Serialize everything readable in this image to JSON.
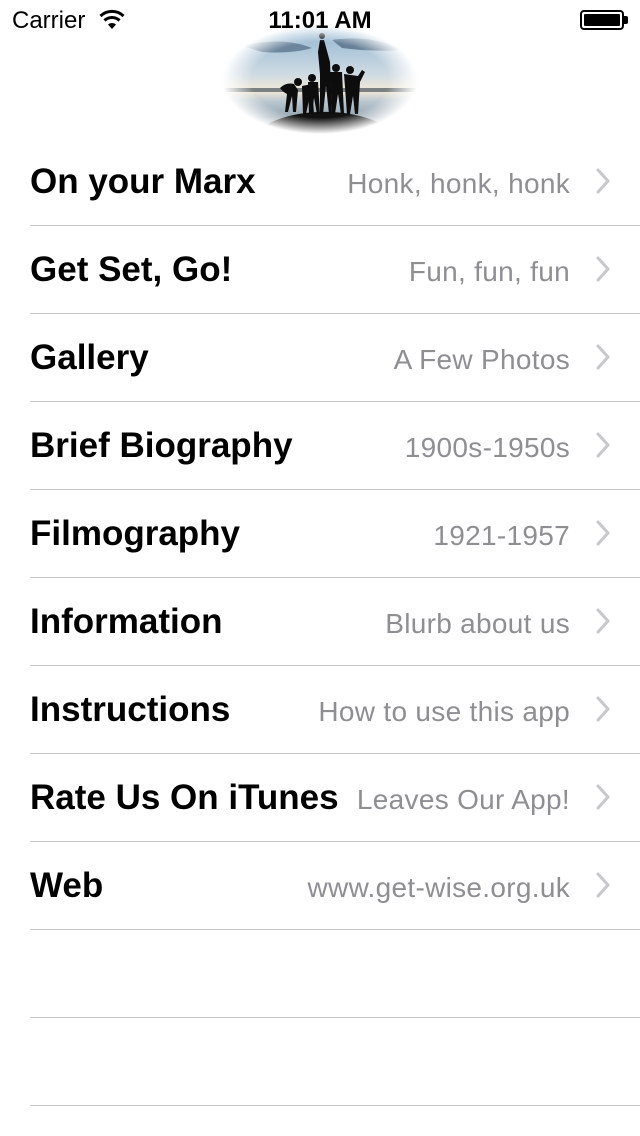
{
  "status_bar": {
    "carrier": "Carrier",
    "time": "11:01 AM",
    "wifi_icon": "wifi-icon",
    "battery_icon": "battery-icon"
  },
  "header": {
    "logo_icon": "group-silhouette-logo"
  },
  "menu": {
    "items": [
      {
        "title": "On your Marx",
        "detail": "Honk, honk, honk"
      },
      {
        "title": "Get Set, Go!",
        "detail": "Fun, fun, fun"
      },
      {
        "title": "Gallery",
        "detail": "A Few Photos"
      },
      {
        "title": "Brief Biography",
        "detail": "1900s-1950s"
      },
      {
        "title": "Filmography",
        "detail": "1921-1957"
      },
      {
        "title": "Information",
        "detail": "Blurb about us"
      },
      {
        "title": "Instructions",
        "detail": "How to use this app"
      },
      {
        "title": "Rate Us On iTunes",
        "detail": "Leaves Our App!"
      },
      {
        "title": "Web",
        "detail": "www.get-wise.org.uk"
      }
    ]
  },
  "colors": {
    "separator": "#c8c7cc",
    "detail_text": "#8e8e93",
    "chevron": "#c7c7cc"
  }
}
